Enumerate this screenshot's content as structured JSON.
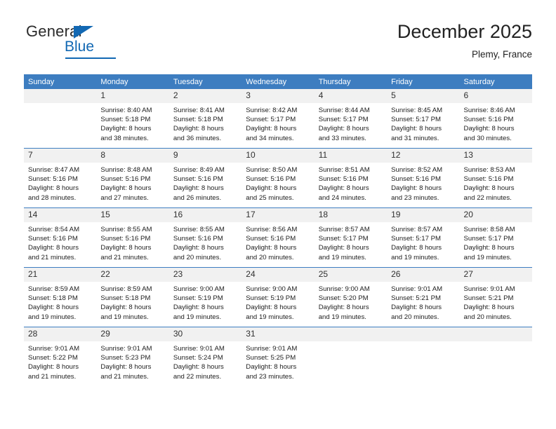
{
  "brand": {
    "word_general": "General",
    "word_blue": "Blue",
    "logo_icon": "triangle-logo"
  },
  "header": {
    "month_title": "December 2025",
    "location": "Plemy, France"
  },
  "calendar": {
    "weekday_headers": [
      "Sunday",
      "Monday",
      "Tuesday",
      "Wednesday",
      "Thursday",
      "Friday",
      "Saturday"
    ],
    "accent_color": "#3d7dc0",
    "daynum_background": "#f1f1f1",
    "weeks": [
      [
        {
          "day": "",
          "sunrise": "",
          "sunset": "",
          "daylight_line1": "",
          "daylight_line2": "",
          "empty": true
        },
        {
          "day": "1",
          "sunrise": "Sunrise: 8:40 AM",
          "sunset": "Sunset: 5:18 PM",
          "daylight_line1": "Daylight: 8 hours",
          "daylight_line2": "and 38 minutes.",
          "empty": false
        },
        {
          "day": "2",
          "sunrise": "Sunrise: 8:41 AM",
          "sunset": "Sunset: 5:18 PM",
          "daylight_line1": "Daylight: 8 hours",
          "daylight_line2": "and 36 minutes.",
          "empty": false
        },
        {
          "day": "3",
          "sunrise": "Sunrise: 8:42 AM",
          "sunset": "Sunset: 5:17 PM",
          "daylight_line1": "Daylight: 8 hours",
          "daylight_line2": "and 34 minutes.",
          "empty": false
        },
        {
          "day": "4",
          "sunrise": "Sunrise: 8:44 AM",
          "sunset": "Sunset: 5:17 PM",
          "daylight_line1": "Daylight: 8 hours",
          "daylight_line2": "and 33 minutes.",
          "empty": false
        },
        {
          "day": "5",
          "sunrise": "Sunrise: 8:45 AM",
          "sunset": "Sunset: 5:17 PM",
          "daylight_line1": "Daylight: 8 hours",
          "daylight_line2": "and 31 minutes.",
          "empty": false
        },
        {
          "day": "6",
          "sunrise": "Sunrise: 8:46 AM",
          "sunset": "Sunset: 5:16 PM",
          "daylight_line1": "Daylight: 8 hours",
          "daylight_line2": "and 30 minutes.",
          "empty": false
        }
      ],
      [
        {
          "day": "7",
          "sunrise": "Sunrise: 8:47 AM",
          "sunset": "Sunset: 5:16 PM",
          "daylight_line1": "Daylight: 8 hours",
          "daylight_line2": "and 28 minutes.",
          "empty": false
        },
        {
          "day": "8",
          "sunrise": "Sunrise: 8:48 AM",
          "sunset": "Sunset: 5:16 PM",
          "daylight_line1": "Daylight: 8 hours",
          "daylight_line2": "and 27 minutes.",
          "empty": false
        },
        {
          "day": "9",
          "sunrise": "Sunrise: 8:49 AM",
          "sunset": "Sunset: 5:16 PM",
          "daylight_line1": "Daylight: 8 hours",
          "daylight_line2": "and 26 minutes.",
          "empty": false
        },
        {
          "day": "10",
          "sunrise": "Sunrise: 8:50 AM",
          "sunset": "Sunset: 5:16 PM",
          "daylight_line1": "Daylight: 8 hours",
          "daylight_line2": "and 25 minutes.",
          "empty": false
        },
        {
          "day": "11",
          "sunrise": "Sunrise: 8:51 AM",
          "sunset": "Sunset: 5:16 PM",
          "daylight_line1": "Daylight: 8 hours",
          "daylight_line2": "and 24 minutes.",
          "empty": false
        },
        {
          "day": "12",
          "sunrise": "Sunrise: 8:52 AM",
          "sunset": "Sunset: 5:16 PM",
          "daylight_line1": "Daylight: 8 hours",
          "daylight_line2": "and 23 minutes.",
          "empty": false
        },
        {
          "day": "13",
          "sunrise": "Sunrise: 8:53 AM",
          "sunset": "Sunset: 5:16 PM",
          "daylight_line1": "Daylight: 8 hours",
          "daylight_line2": "and 22 minutes.",
          "empty": false
        }
      ],
      [
        {
          "day": "14",
          "sunrise": "Sunrise: 8:54 AM",
          "sunset": "Sunset: 5:16 PM",
          "daylight_line1": "Daylight: 8 hours",
          "daylight_line2": "and 21 minutes.",
          "empty": false
        },
        {
          "day": "15",
          "sunrise": "Sunrise: 8:55 AM",
          "sunset": "Sunset: 5:16 PM",
          "daylight_line1": "Daylight: 8 hours",
          "daylight_line2": "and 21 minutes.",
          "empty": false
        },
        {
          "day": "16",
          "sunrise": "Sunrise: 8:55 AM",
          "sunset": "Sunset: 5:16 PM",
          "daylight_line1": "Daylight: 8 hours",
          "daylight_line2": "and 20 minutes.",
          "empty": false
        },
        {
          "day": "17",
          "sunrise": "Sunrise: 8:56 AM",
          "sunset": "Sunset: 5:16 PM",
          "daylight_line1": "Daylight: 8 hours",
          "daylight_line2": "and 20 minutes.",
          "empty": false
        },
        {
          "day": "18",
          "sunrise": "Sunrise: 8:57 AM",
          "sunset": "Sunset: 5:17 PM",
          "daylight_line1": "Daylight: 8 hours",
          "daylight_line2": "and 19 minutes.",
          "empty": false
        },
        {
          "day": "19",
          "sunrise": "Sunrise: 8:57 AM",
          "sunset": "Sunset: 5:17 PM",
          "daylight_line1": "Daylight: 8 hours",
          "daylight_line2": "and 19 minutes.",
          "empty": false
        },
        {
          "day": "20",
          "sunrise": "Sunrise: 8:58 AM",
          "sunset": "Sunset: 5:17 PM",
          "daylight_line1": "Daylight: 8 hours",
          "daylight_line2": "and 19 minutes.",
          "empty": false
        }
      ],
      [
        {
          "day": "21",
          "sunrise": "Sunrise: 8:59 AM",
          "sunset": "Sunset: 5:18 PM",
          "daylight_line1": "Daylight: 8 hours",
          "daylight_line2": "and 19 minutes.",
          "empty": false
        },
        {
          "day": "22",
          "sunrise": "Sunrise: 8:59 AM",
          "sunset": "Sunset: 5:18 PM",
          "daylight_line1": "Daylight: 8 hours",
          "daylight_line2": "and 19 minutes.",
          "empty": false
        },
        {
          "day": "23",
          "sunrise": "Sunrise: 9:00 AM",
          "sunset": "Sunset: 5:19 PM",
          "daylight_line1": "Daylight: 8 hours",
          "daylight_line2": "and 19 minutes.",
          "empty": false
        },
        {
          "day": "24",
          "sunrise": "Sunrise: 9:00 AM",
          "sunset": "Sunset: 5:19 PM",
          "daylight_line1": "Daylight: 8 hours",
          "daylight_line2": "and 19 minutes.",
          "empty": false
        },
        {
          "day": "25",
          "sunrise": "Sunrise: 9:00 AM",
          "sunset": "Sunset: 5:20 PM",
          "daylight_line1": "Daylight: 8 hours",
          "daylight_line2": "and 19 minutes.",
          "empty": false
        },
        {
          "day": "26",
          "sunrise": "Sunrise: 9:01 AM",
          "sunset": "Sunset: 5:21 PM",
          "daylight_line1": "Daylight: 8 hours",
          "daylight_line2": "and 20 minutes.",
          "empty": false
        },
        {
          "day": "27",
          "sunrise": "Sunrise: 9:01 AM",
          "sunset": "Sunset: 5:21 PM",
          "daylight_line1": "Daylight: 8 hours",
          "daylight_line2": "and 20 minutes.",
          "empty": false
        }
      ],
      [
        {
          "day": "28",
          "sunrise": "Sunrise: 9:01 AM",
          "sunset": "Sunset: 5:22 PM",
          "daylight_line1": "Daylight: 8 hours",
          "daylight_line2": "and 21 minutes.",
          "empty": false
        },
        {
          "day": "29",
          "sunrise": "Sunrise: 9:01 AM",
          "sunset": "Sunset: 5:23 PM",
          "daylight_line1": "Daylight: 8 hours",
          "daylight_line2": "and 21 minutes.",
          "empty": false
        },
        {
          "day": "30",
          "sunrise": "Sunrise: 9:01 AM",
          "sunset": "Sunset: 5:24 PM",
          "daylight_line1": "Daylight: 8 hours",
          "daylight_line2": "and 22 minutes.",
          "empty": false
        },
        {
          "day": "31",
          "sunrise": "Sunrise: 9:01 AM",
          "sunset": "Sunset: 5:25 PM",
          "daylight_line1": "Daylight: 8 hours",
          "daylight_line2": "and 23 minutes.",
          "empty": false
        },
        {
          "day": "",
          "sunrise": "",
          "sunset": "",
          "daylight_line1": "",
          "daylight_line2": "",
          "empty": true
        },
        {
          "day": "",
          "sunrise": "",
          "sunset": "",
          "daylight_line1": "",
          "daylight_line2": "",
          "empty": true
        },
        {
          "day": "",
          "sunrise": "",
          "sunset": "",
          "daylight_line1": "",
          "daylight_line2": "",
          "empty": true
        }
      ]
    ]
  }
}
